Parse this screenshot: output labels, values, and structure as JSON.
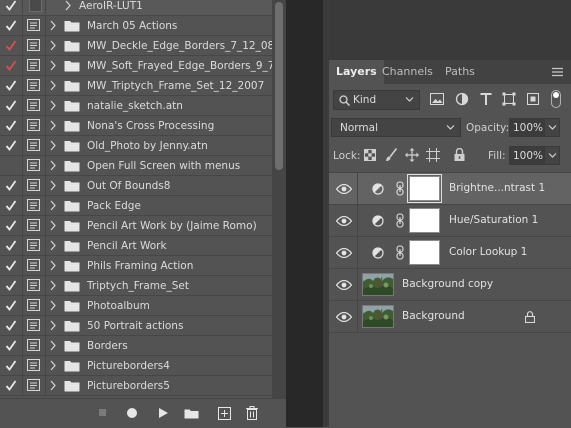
{
  "actions": {
    "top_row": {
      "label": "AeroIR-LUT1",
      "checked": true
    },
    "rows": [
      {
        "label": "March 05 Actions",
        "check": "white"
      },
      {
        "label": "MW_Deckle_Edge_Borders_7_12_08",
        "check": "red"
      },
      {
        "label": "MW_Soft_Frayed_Edge_Borders_9_7...",
        "check": "red"
      },
      {
        "label": "MW_Triptych_Frame_Set_12_2007",
        "check": "white"
      },
      {
        "label": "natalie_sketch.atn",
        "check": "white"
      },
      {
        "label": "Nona's Cross Processing",
        "check": "white"
      },
      {
        "label": "Old_Photo by Jenny.atn",
        "check": "white"
      },
      {
        "label": "Open Full Screen with menus",
        "check": "none"
      },
      {
        "label": "Out Of Bounds8",
        "check": "white"
      },
      {
        "label": "Pack Edge",
        "check": "white"
      },
      {
        "label": "Pencil Art Work by (Jaime Romo)",
        "check": "white"
      },
      {
        "label": "Pencil Art Work",
        "check": "white"
      },
      {
        "label": "Phils Framing Action",
        "check": "white"
      },
      {
        "label": "Triptych_Frame_Set",
        "check": "white"
      },
      {
        "label": "Photoalbum",
        "check": "white"
      },
      {
        "label": "50 Portrait actions",
        "check": "white"
      },
      {
        "label": "Borders",
        "check": "white"
      },
      {
        "label": "Pictureborders4",
        "check": "white"
      },
      {
        "label": "Pictureborders5",
        "check": "white"
      }
    ],
    "bottom_icons": [
      "stop-icon",
      "record-icon",
      "play-icon",
      "folder-icon",
      "new-action-icon",
      "trash-icon"
    ]
  },
  "layers_panel": {
    "tabs": [
      {
        "label": "Layers",
        "active": true
      },
      {
        "label": "Channels",
        "active": false
      },
      {
        "label": "Paths",
        "active": false
      }
    ],
    "filter": {
      "label": "Kind",
      "icons": [
        "image-filter-icon",
        "adjustment-filter-icon",
        "type-filter-icon",
        "shape-filter-icon",
        "smart-object-filter-icon"
      ]
    },
    "blend_mode": "Normal",
    "opacity_label": "Opacity:",
    "opacity_value": "100%",
    "lock_label": "Lock:",
    "fill_label": "Fill:",
    "fill_value": "100%",
    "layers": [
      {
        "name": "Brightne...ntrast 1",
        "type": "adjustment",
        "selected": true
      },
      {
        "name": "Hue/Saturation 1",
        "type": "adjustment",
        "selected": false
      },
      {
        "name": "Color Lookup 1",
        "type": "adjustment",
        "selected": false
      },
      {
        "name": "Background copy",
        "type": "image",
        "selected": false
      },
      {
        "name": "Background",
        "type": "image",
        "selected": false,
        "locked": true
      }
    ]
  },
  "colors": {
    "panel_bg": "#535353",
    "dark_bg": "#282828",
    "red_check": "#d84f4f"
  }
}
